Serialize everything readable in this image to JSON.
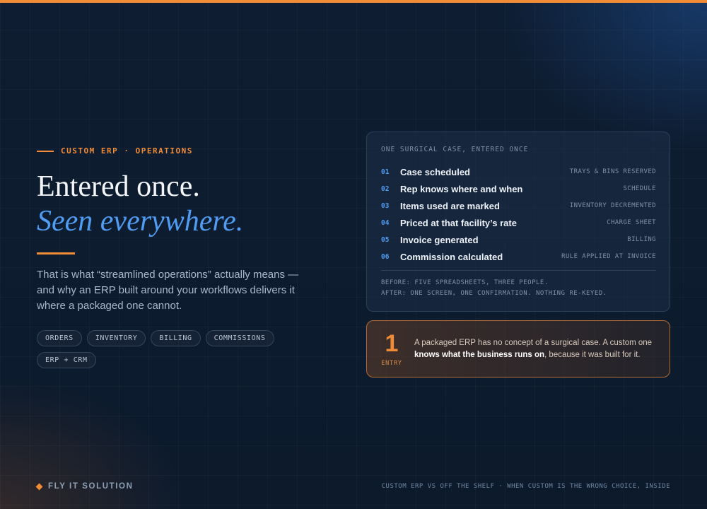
{
  "colors": {
    "accent": "#f28b35",
    "highlight": "#4f9cf2",
    "background": "#0d1b2e"
  },
  "hero": {
    "eyebrow": "CUSTOM ERP · OPERATIONS",
    "headline_line1": "Entered once.",
    "headline_line2": "Seen everywhere.",
    "lede": "That is what “streamlined operations” actually means — and why an ERP built around your workflows delivers it where a packaged one cannot.",
    "pills": [
      "ORDERS",
      "INVENTORY",
      "BILLING",
      "COMMISSIONS",
      "ERP + CRM"
    ]
  },
  "flow_card": {
    "title": "ONE SURGICAL CASE, ENTERED ONCE",
    "steps": [
      {
        "num": "01",
        "label": "Case scheduled",
        "tag": "TRAYS & BINS RESERVED"
      },
      {
        "num": "02",
        "label": "Rep knows where and when",
        "tag": "SCHEDULE"
      },
      {
        "num": "03",
        "label": "Items used are marked",
        "tag": "INVENTORY DECREMENTED"
      },
      {
        "num": "04",
        "label": "Priced at that facility’s rate",
        "tag": "CHARGE SHEET"
      },
      {
        "num": "05",
        "label": "Invoice generated",
        "tag": "BILLING"
      },
      {
        "num": "06",
        "label": "Commission calculated",
        "tag": "RULE APPLIED AT INVOICE"
      }
    ],
    "before": "BEFORE: FIVE SPREADSHEETS, THREE PEOPLE.",
    "after": "AFTER: ONE SCREEN, ONE CONFIRMATION. NOTHING RE-KEYED."
  },
  "callout": {
    "number": "1",
    "caption": "ENTRY",
    "text_before": "A packaged ERP has no concept of a surgical case. A custom one ",
    "text_strong": "knows what the business runs on",
    "text_after": ", because it was built for it."
  },
  "footer": {
    "brand": "FLY IT SOLUTION",
    "note": "CUSTOM ERP VS OFF THE SHELF · WHEN CUSTOM IS THE WRONG CHOICE, INSIDE"
  }
}
